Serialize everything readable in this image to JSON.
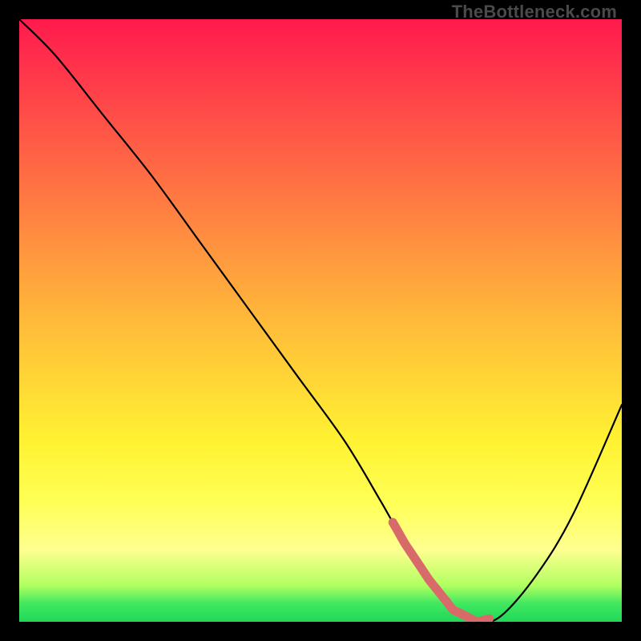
{
  "watermark": "TheBottleneck.com",
  "chart_data": {
    "type": "line",
    "title": "",
    "xlabel": "",
    "ylabel": "",
    "xlim": [
      0,
      100
    ],
    "ylim": [
      0,
      100
    ],
    "x": [
      0,
      6,
      14,
      22,
      30,
      38,
      46,
      54,
      60,
      64,
      68,
      72,
      76,
      80,
      86,
      92,
      100
    ],
    "values": [
      100,
      94,
      84,
      74,
      63,
      52,
      41,
      30,
      20,
      13,
      7,
      2,
      0,
      1,
      8,
      18,
      36
    ],
    "background_gradient": [
      "#ff1a4d",
      "#ff9a3e",
      "#ffff55",
      "#20d858"
    ],
    "highlight_band": {
      "x_start": 62,
      "x_end": 78,
      "color": "#d86a6a"
    }
  }
}
